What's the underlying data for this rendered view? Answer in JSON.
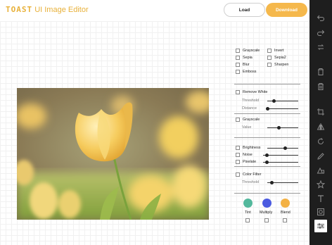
{
  "header": {
    "logo_brand": "TOAST",
    "logo_title": "UI Image Editor",
    "load_label": "Load",
    "download_label": "Download"
  },
  "filters": {
    "basic": [
      {
        "label": "Grayscale",
        "checked": false
      },
      {
        "label": "Invert",
        "checked": false
      },
      {
        "label": "Sepia",
        "checked": false
      },
      {
        "label": "Sepia2",
        "checked": false
      },
      {
        "label": "Blur",
        "checked": false
      },
      {
        "label": "Sharpen",
        "checked": false
      },
      {
        "label": "Emboss",
        "checked": false
      }
    ],
    "remove_white": {
      "label": "Remove White",
      "checked": false,
      "threshold_label": "Threshold",
      "threshold": 0.25,
      "distance_label": "Distance",
      "distance": 0.05
    },
    "grayscale2": {
      "label": "Grayscale",
      "checked": false,
      "value_label": "Value",
      "value": 0.45
    },
    "adjust": [
      {
        "label": "Brightness",
        "checked": false,
        "value": 0.7
      },
      {
        "label": "Noise",
        "checked": false,
        "value": 0.1
      },
      {
        "label": "Pixelate",
        "checked": false,
        "value": 0.1
      }
    ],
    "color_filter": {
      "label": "Color Filter",
      "checked": false,
      "threshold_label": "Threshold",
      "threshold": 0.25
    },
    "colors": [
      {
        "label": "Tint",
        "color": "#53b89c"
      },
      {
        "label": "Multiply",
        "color": "#4b5be0"
      },
      {
        "label": "Blend",
        "color": "#f3b144"
      }
    ]
  },
  "toolbar": {
    "tools": [
      "undo-icon",
      "redo-icon",
      "reset-icon",
      "delete-icon",
      "delete-all-icon",
      "crop-icon",
      "flip-icon",
      "rotate-icon",
      "draw-icon",
      "shape-icon",
      "icon-icon",
      "text-icon",
      "mask-icon",
      "filter-icon"
    ],
    "active": "filter-icon"
  },
  "colors": {
    "accent": "#f5b84c",
    "toolbar_bg": "#1e1e1e"
  }
}
